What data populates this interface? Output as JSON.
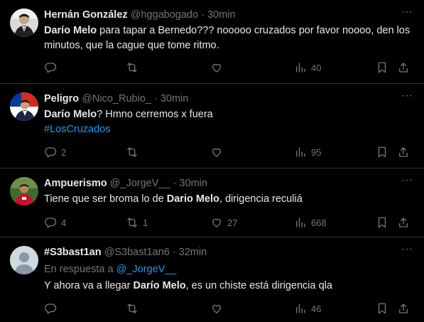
{
  "tweets": [
    {
      "name": "Hernán González",
      "handle": "@hggabogado",
      "dot": "·",
      "time": "30min",
      "text_bold": "Darío Melo",
      "text_rest": " para tapar a Bernedo??? nooooo cruzados por favor noooo, den los minutos, que la cague que tome ritmo.",
      "replies": "",
      "retweets": "",
      "likes": "",
      "views": "40"
    },
    {
      "name": "Peligro",
      "handle": "@Nico_Rubio_",
      "dot": "·",
      "time": "30min",
      "text_bold": "Darío Melo",
      "text_rest": "? Hmno cerremos x fuera",
      "hashtag": "#LosCruzados",
      "replies": "2",
      "retweets": "",
      "likes": "",
      "views": "95"
    },
    {
      "name": "Ampuerismo",
      "handle": "@_JorgeV__",
      "dot": "·",
      "time": "30min",
      "text_pre": "Tiene que ser broma lo de ",
      "text_bold": "Dario Melo",
      "text_rest": ", dirigencia reculiá",
      "replies": "4",
      "retweets": "1",
      "likes": "27",
      "views": "668"
    },
    {
      "name": "#S3bast1an",
      "handle": "@S3bast1an6",
      "dot": "·",
      "time": "32min",
      "reply_prefix": "En respuesta a ",
      "reply_mention": "@_JorgeV__",
      "text_pre": "Y ahora va a llegar ",
      "text_bold": "Darío Melo",
      "text_rest": ", es un chiste está dirigencia qla",
      "replies": "",
      "retweets": "",
      "likes": "",
      "views": "46"
    }
  ],
  "more_glyph": "···",
  "icons": [
    "reply-icon",
    "retweet-icon",
    "like-icon",
    "views-icon",
    "bookmark-icon",
    "share-icon",
    "more-icon"
  ],
  "colors": {
    "background": "#000000",
    "text": "#e7e9ea",
    "muted": "#71767b",
    "link": "#1d9bf0",
    "divider": "#2f3336"
  }
}
